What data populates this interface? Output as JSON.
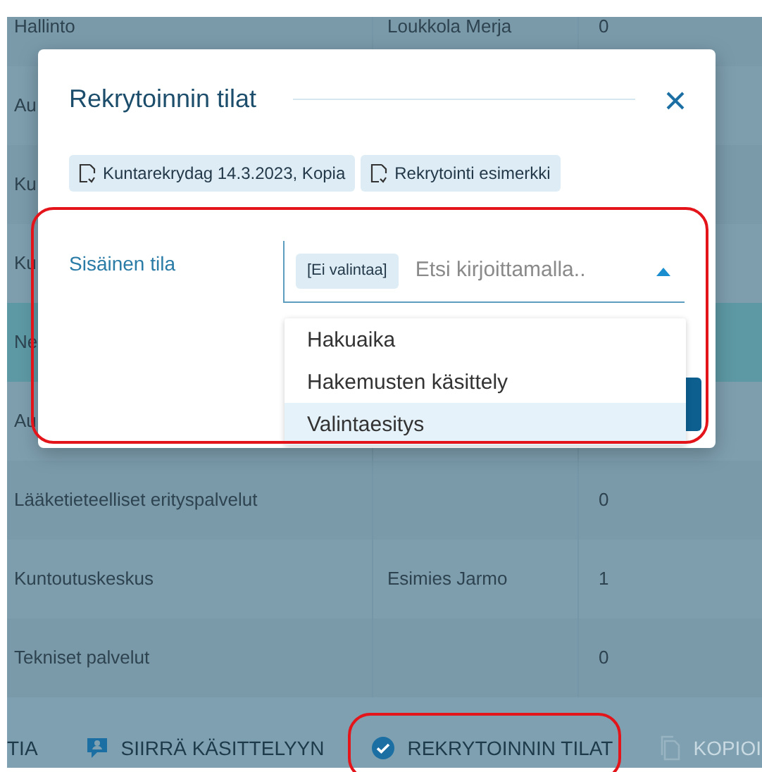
{
  "table": {
    "rows": [
      {
        "cells": [
          "Hallinto",
          "Loukkola Merja",
          "0"
        ],
        "selected": false
      },
      {
        "cells": [
          "Au"
        ],
        "selected": false
      },
      {
        "cells": [
          "Ku"
        ],
        "selected": false
      },
      {
        "cells": [
          "Ku"
        ],
        "selected": false
      },
      {
        "cells": [
          "Ne"
        ],
        "selected": true
      },
      {
        "cells": [
          "Au"
        ],
        "selected": false
      },
      {
        "cells": [
          "Lääketieteelliset erityspalvelut",
          "",
          "0"
        ],
        "selected": false
      },
      {
        "cells": [
          "Kuntoutuskeskus",
          "Esimies Jarmo",
          "1"
        ],
        "selected": false
      },
      {
        "cells": [
          "Tekniset palvelut",
          "",
          "0"
        ],
        "selected": false
      }
    ]
  },
  "toolbar": [
    {
      "label": "TIA",
      "kind": "plain",
      "disabled": false
    },
    {
      "label": "SIIRRÄ KÄSITTELYYN",
      "kind": "move",
      "disabled": false
    },
    {
      "label": "REKRYTOINNIN TILAT",
      "kind": "states",
      "disabled": false
    },
    {
      "label": "KOPIOI",
      "kind": "copy",
      "disabled": true
    }
  ],
  "dialog": {
    "title": "Rekrytoinnin tilat",
    "chips": [
      "Kuntarekrydag 14.3.2023, Kopia",
      "Rekrytointi esimerkki"
    ],
    "field": {
      "label": "Sisäinen tila",
      "value_chip": "[Ei valintaa]",
      "placeholder": "Etsi kirjoittamalla..",
      "expanded": true,
      "options": [
        {
          "label": "Hakuaika",
          "selected": false
        },
        {
          "label": "Hakemusten käsittely",
          "selected": false
        },
        {
          "label": "Valintaesitys",
          "selected": true
        }
      ]
    }
  },
  "annotations": [
    {
      "kind": "highlight"
    },
    {
      "kind": "highlight"
    }
  ]
}
